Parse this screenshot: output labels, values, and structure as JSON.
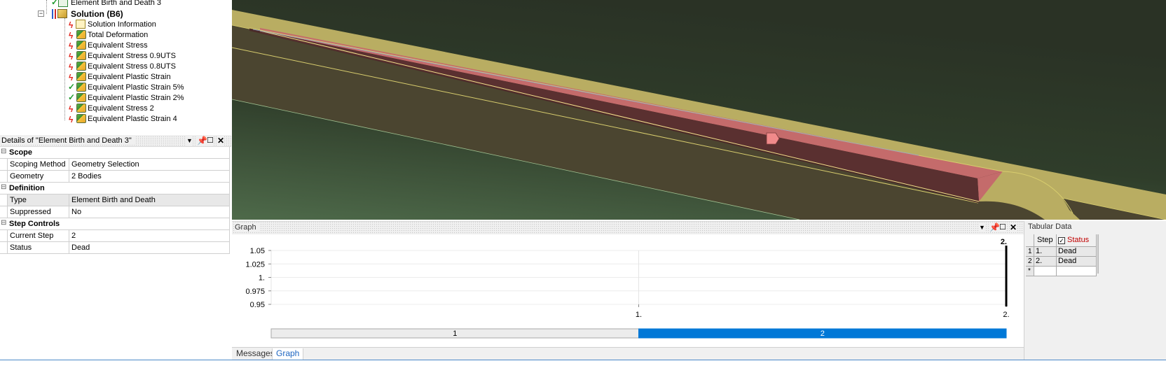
{
  "tree": {
    "items": [
      {
        "label": "Element Birth and Death 3",
        "status": "ok",
        "icon": "birth-death-icon"
      },
      {
        "label": "Solution (B6)",
        "status": "solve",
        "icon": "solution-icon",
        "bold": true
      },
      {
        "label": "Solution Information",
        "status": "x",
        "icon": "solution-info-icon"
      },
      {
        "label": "Total Deformation",
        "status": "x",
        "icon": "result-icon"
      },
      {
        "label": "Equivalent Stress",
        "status": "x",
        "icon": "result-icon"
      },
      {
        "label": "Equivalent Stress 0.9UTS",
        "status": "x",
        "icon": "result-icon"
      },
      {
        "label": "Equivalent Stress 0.8UTS",
        "status": "x",
        "icon": "result-icon"
      },
      {
        "label": "Equivalent Plastic Strain",
        "status": "x",
        "icon": "result-icon"
      },
      {
        "label": "Equivalent Plastic Strain 5%",
        "status": "ok",
        "icon": "result-icon"
      },
      {
        "label": "Equivalent Plastic Strain 2%",
        "status": "ok",
        "icon": "result-icon"
      },
      {
        "label": "Equivalent Stress 2",
        "status": "x",
        "icon": "result-icon"
      },
      {
        "label": "Equivalent Plastic Strain 4",
        "status": "x",
        "icon": "result-icon"
      }
    ]
  },
  "details": {
    "title": "Details of \"Element Birth and Death 3\"",
    "sections": {
      "scope": "Scope",
      "definition": "Definition",
      "step_controls": "Step Controls"
    },
    "rows": {
      "scoping_method": {
        "key": "Scoping Method",
        "value": "Geometry Selection"
      },
      "geometry": {
        "key": "Geometry",
        "value": "2 Bodies"
      },
      "type": {
        "key": "Type",
        "value": "Element Birth and Death"
      },
      "suppressed": {
        "key": "Suppressed",
        "value": "No"
      },
      "current_step": {
        "key": "Current Step",
        "value": "2"
      },
      "status": {
        "key": "Status",
        "value": "Dead"
      }
    }
  },
  "graph": {
    "title": "Graph",
    "yticks": [
      "1.05",
      "1.025",
      "1.",
      "0.975",
      "0.95"
    ],
    "xticks": [
      "1.",
      "2."
    ],
    "top_marker": "2.",
    "steps": [
      "1",
      "2"
    ],
    "active_step_index": 1
  },
  "tabs": {
    "messages": "Messages",
    "graph": "Graph"
  },
  "tabular": {
    "title": "Tabular Data",
    "columns": {
      "step": "Step",
      "status": "Status"
    },
    "rows": [
      {
        "n": "1",
        "step": "1.",
        "status": "Dead"
      },
      {
        "n": "2",
        "step": "2.",
        "status": "Dead"
      }
    ],
    "new_row_marker": "*"
  },
  "colors": {
    "accent": "#0078d7",
    "status_header": "#c00000",
    "viewport_body": "#4b4530",
    "viewport_highlight": "#c46b6b",
    "viewport_edge": "#d8cd6e"
  }
}
